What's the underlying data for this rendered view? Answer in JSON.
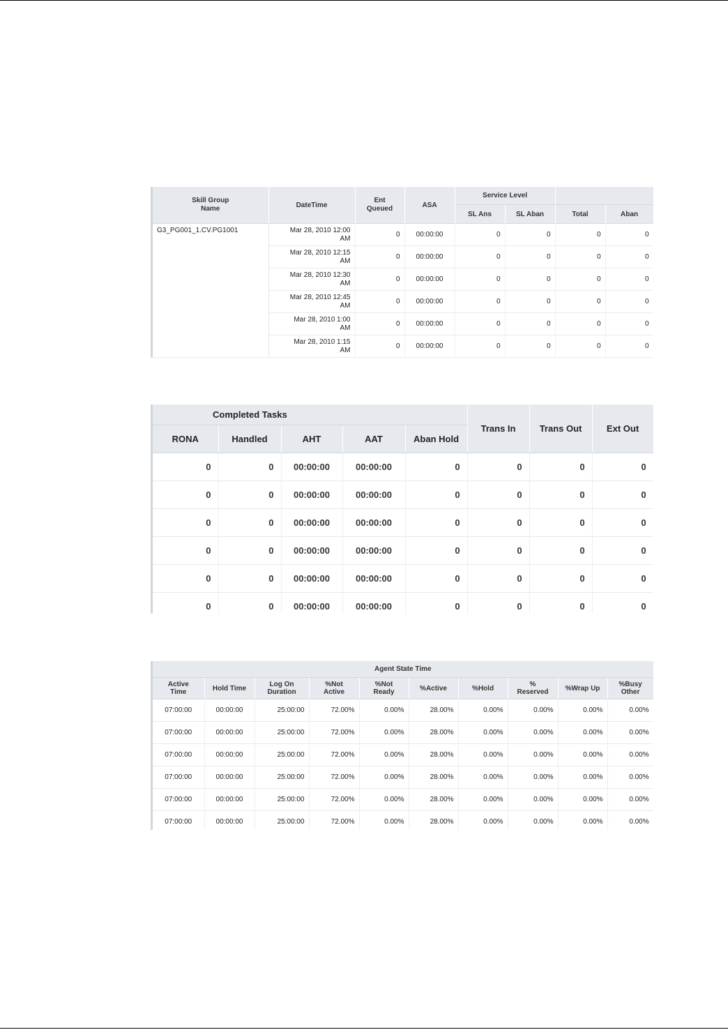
{
  "table1": {
    "headers": {
      "skill_group_name": "Skill Group\nName",
      "datetime": "DateTime",
      "ent_queued": "Ent\nQueued",
      "asa": "ASA",
      "service_level": "Service Level",
      "sl_ans": "SL Ans",
      "sl_aban": "SL Aban",
      "total": "Total",
      "aban": "Aban"
    },
    "skill_group": "G3_PG001_1.CV.PG1001",
    "rows": [
      {
        "datetime": "Mar 28, 2010 12:00\nAM",
        "ent_queued": "0",
        "asa": "00:00:00",
        "sl_ans": "0",
        "sl_aban": "0",
        "total": "0",
        "aban": "0"
      },
      {
        "datetime": "Mar 28, 2010 12:15\nAM",
        "ent_queued": "0",
        "asa": "00:00:00",
        "sl_ans": "0",
        "sl_aban": "0",
        "total": "0",
        "aban": "0"
      },
      {
        "datetime": "Mar 28, 2010 12:30\nAM",
        "ent_queued": "0",
        "asa": "00:00:00",
        "sl_ans": "0",
        "sl_aban": "0",
        "total": "0",
        "aban": "0"
      },
      {
        "datetime": "Mar 28, 2010 12:45\nAM",
        "ent_queued": "0",
        "asa": "00:00:00",
        "sl_ans": "0",
        "sl_aban": "0",
        "total": "0",
        "aban": "0"
      },
      {
        "datetime": "Mar 28, 2010 1:00\nAM",
        "ent_queued": "0",
        "asa": "00:00:00",
        "sl_ans": "0",
        "sl_aban": "0",
        "total": "0",
        "aban": "0"
      },
      {
        "datetime": "Mar 28, 2010 1:15\nAM",
        "ent_queued": "0",
        "asa": "00:00:00",
        "sl_ans": "0",
        "sl_aban": "0",
        "total": "0",
        "aban": "0"
      }
    ]
  },
  "table2": {
    "headers": {
      "completed_tasks": "Completed Tasks",
      "rona": "RONA",
      "handled": "Handled",
      "aht": "AHT",
      "aat": "AAT",
      "aban_hold": "Aban Hold",
      "trans_in": "Trans In",
      "trans_out": "Trans Out",
      "ext_out": "Ext Out"
    },
    "rows": [
      {
        "rona": "0",
        "handled": "0",
        "aht": "00:00:00",
        "aat": "00:00:00",
        "aban_hold": "0",
        "trans_in": "0",
        "trans_out": "0",
        "ext_out": "0"
      },
      {
        "rona": "0",
        "handled": "0",
        "aht": "00:00:00",
        "aat": "00:00:00",
        "aban_hold": "0",
        "trans_in": "0",
        "trans_out": "0",
        "ext_out": "0"
      },
      {
        "rona": "0",
        "handled": "0",
        "aht": "00:00:00",
        "aat": "00:00:00",
        "aban_hold": "0",
        "trans_in": "0",
        "trans_out": "0",
        "ext_out": "0"
      },
      {
        "rona": "0",
        "handled": "0",
        "aht": "00:00:00",
        "aat": "00:00:00",
        "aban_hold": "0",
        "trans_in": "0",
        "trans_out": "0",
        "ext_out": "0"
      },
      {
        "rona": "0",
        "handled": "0",
        "aht": "00:00:00",
        "aat": "00:00:00",
        "aban_hold": "0",
        "trans_in": "0",
        "trans_out": "0",
        "ext_out": "0"
      },
      {
        "rona": "0",
        "handled": "0",
        "aht": "00:00:00",
        "aat": "00:00:00",
        "aban_hold": "0",
        "trans_in": "0",
        "trans_out": "0",
        "ext_out": "0"
      }
    ]
  },
  "table3": {
    "headers": {
      "agent_state_time": "Agent State Time",
      "active_time": "Active\nTime",
      "hold_time": "Hold Time",
      "log_on_duration": "Log On\nDuration",
      "pct_not_active": "%Not\nActive",
      "pct_not_ready": "%Not\nReady",
      "pct_active": "%Active",
      "pct_hold": "%Hold",
      "pct_reserved": "%\nReserved",
      "pct_wrap_up": "%Wrap Up",
      "pct_busy_other": "%Busy\nOther"
    },
    "rows": [
      {
        "active_time": "07:00:00",
        "hold_time": "00:00:00",
        "log_on_duration": "25:00:00",
        "pct_not_active": "72.00%",
        "pct_not_ready": "0.00%",
        "pct_active": "28.00%",
        "pct_hold": "0.00%",
        "pct_reserved": "0.00%",
        "pct_wrap_up": "0.00%",
        "pct_busy_other": "0.00%"
      },
      {
        "active_time": "07:00:00",
        "hold_time": "00:00:00",
        "log_on_duration": "25:00:00",
        "pct_not_active": "72.00%",
        "pct_not_ready": "0.00%",
        "pct_active": "28.00%",
        "pct_hold": "0.00%",
        "pct_reserved": "0.00%",
        "pct_wrap_up": "0.00%",
        "pct_busy_other": "0.00%"
      },
      {
        "active_time": "07:00:00",
        "hold_time": "00:00:00",
        "log_on_duration": "25:00:00",
        "pct_not_active": "72.00%",
        "pct_not_ready": "0.00%",
        "pct_active": "28.00%",
        "pct_hold": "0.00%",
        "pct_reserved": "0.00%",
        "pct_wrap_up": "0.00%",
        "pct_busy_other": "0.00%"
      },
      {
        "active_time": "07:00:00",
        "hold_time": "00:00:00",
        "log_on_duration": "25:00:00",
        "pct_not_active": "72.00%",
        "pct_not_ready": "0.00%",
        "pct_active": "28.00%",
        "pct_hold": "0.00%",
        "pct_reserved": "0.00%",
        "pct_wrap_up": "0.00%",
        "pct_busy_other": "0.00%"
      },
      {
        "active_time": "07:00:00",
        "hold_time": "00:00:00",
        "log_on_duration": "25:00:00",
        "pct_not_active": "72.00%",
        "pct_not_ready": "0.00%",
        "pct_active": "28.00%",
        "pct_hold": "0.00%",
        "pct_reserved": "0.00%",
        "pct_wrap_up": "0.00%",
        "pct_busy_other": "0.00%"
      },
      {
        "active_time": "07:00:00",
        "hold_time": "00:00:00",
        "log_on_duration": "25:00:00",
        "pct_not_active": "72.00%",
        "pct_not_ready": "0.00%",
        "pct_active": "28.00%",
        "pct_hold": "0.00%",
        "pct_reserved": "0.00%",
        "pct_wrap_up": "0.00%",
        "pct_busy_other": "0.00%"
      }
    ]
  }
}
